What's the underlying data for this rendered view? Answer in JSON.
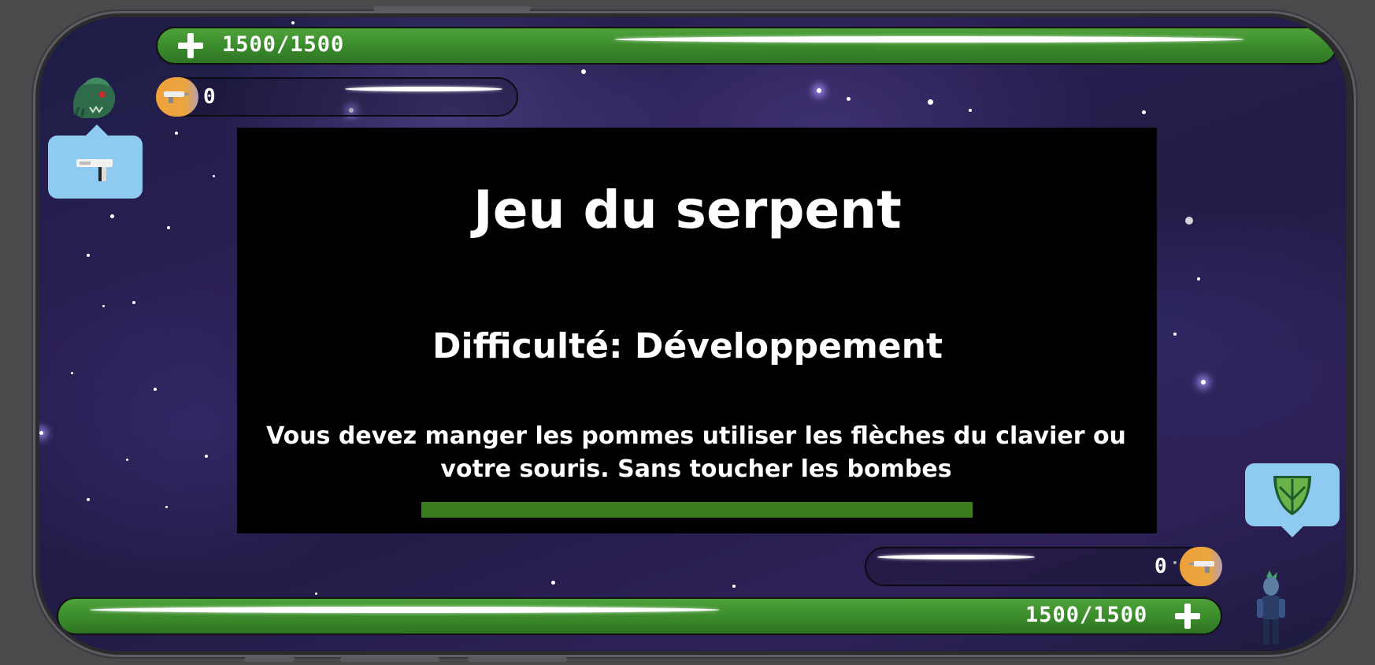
{
  "game": {
    "title": "Jeu du serpent",
    "difficulty_text": "Difficulté: Développement",
    "instructions": "Vous devez manger les pommes utiliser les flèches du clavier ou votre souris. Sans toucher les bombes",
    "loading_progress": 1.0
  },
  "enemy": {
    "hp_text": "1500/1500",
    "hp_fraction": 1.0,
    "ammo_value": "0",
    "avatar_icon": "green-monster-icon",
    "weapon_icon": "laser-gun-icon"
  },
  "player": {
    "hp_text": "1500/1500",
    "hp_fraction": 1.0,
    "ammo_value": "0",
    "avatar_icon": "alien-soldier-icon",
    "shield_icon": "green-shield-icon"
  },
  "colors": {
    "hp_green": "#3a8a2b",
    "ammo_orange": "#e9a441",
    "bubble_blue": "#8fcaf0",
    "dialog_bg": "#000000",
    "progress_green": "#3c7d22"
  }
}
